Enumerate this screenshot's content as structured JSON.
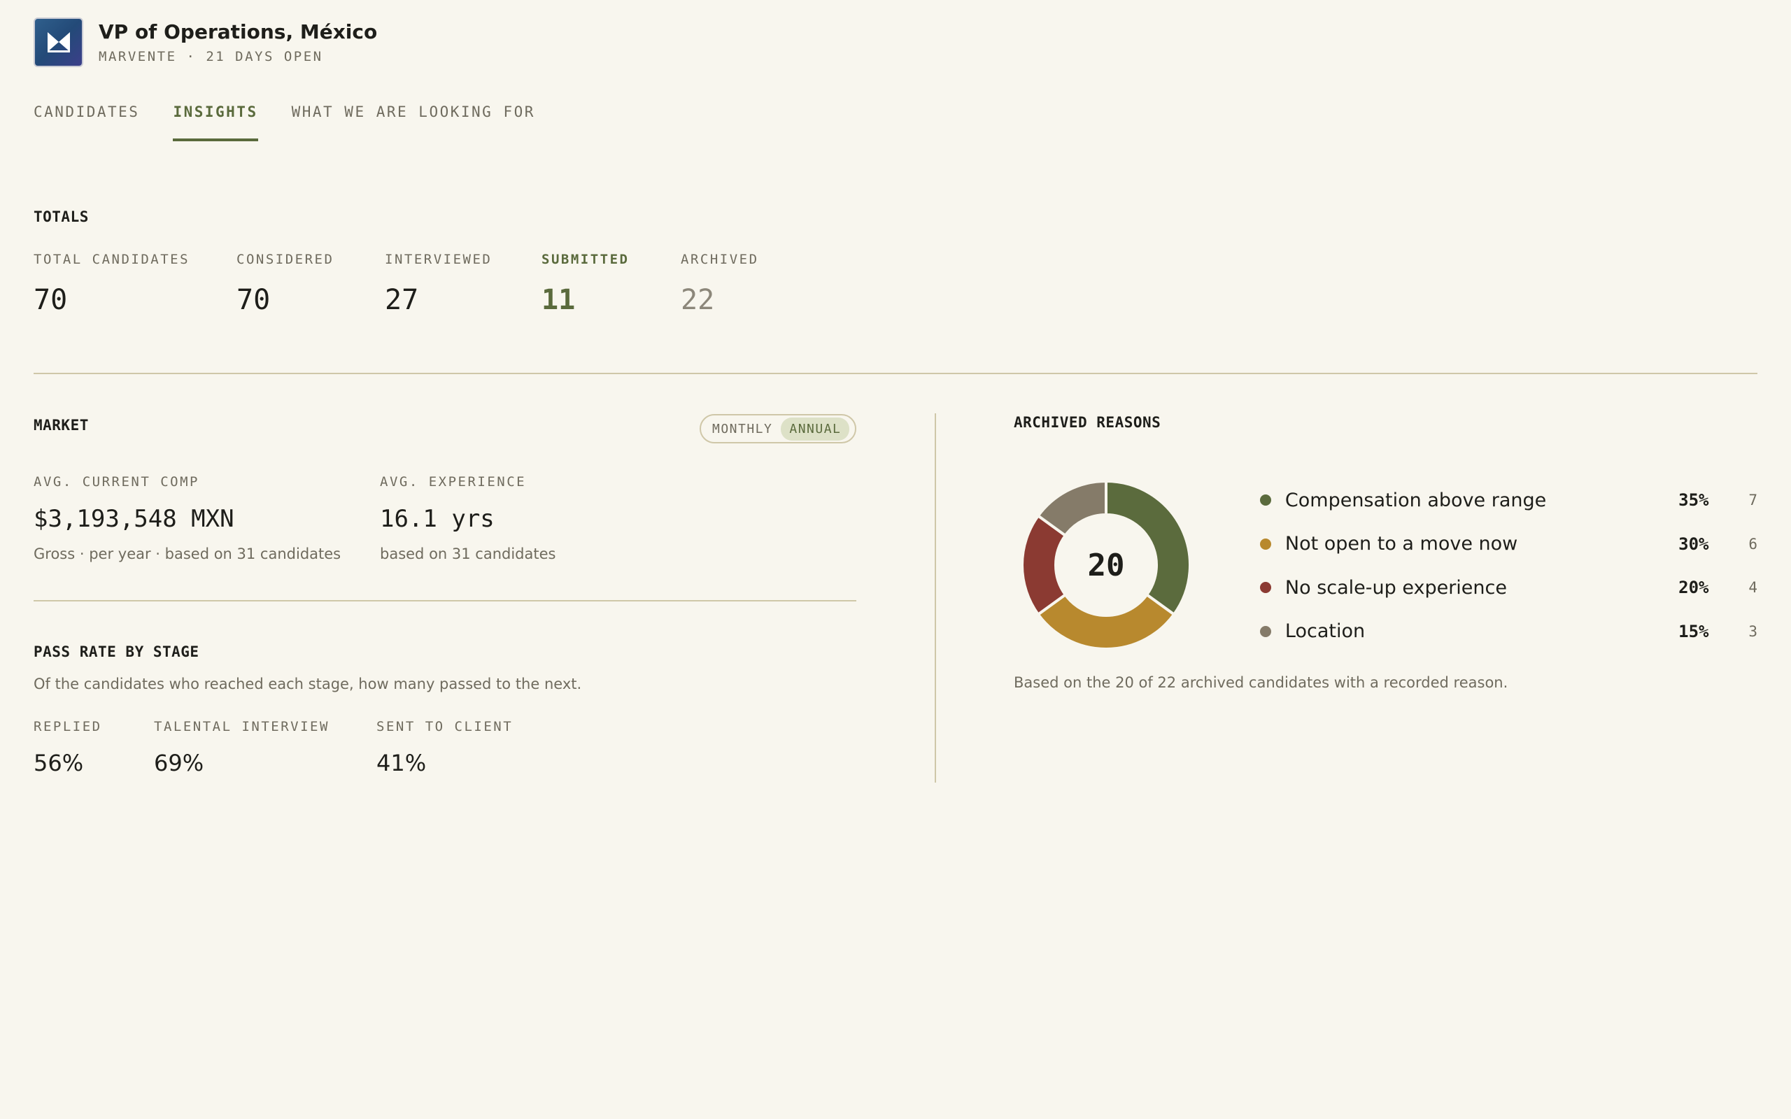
{
  "header": {
    "title": "VP of Operations, México",
    "subtitle": "MARVENTE · 21 DAYS OPEN"
  },
  "tabs": [
    {
      "label": "CANDIDATES",
      "active": false
    },
    {
      "label": "INSIGHTS",
      "active": true
    },
    {
      "label": "WHAT WE ARE LOOKING FOR",
      "active": false
    }
  ],
  "totals": {
    "heading": "TOTALS",
    "items": [
      {
        "label": "TOTAL CANDIDATES",
        "value": "70"
      },
      {
        "label": "CONSIDERED",
        "value": "70"
      },
      {
        "label": "INTERVIEWED",
        "value": "27"
      },
      {
        "label": "SUBMITTED",
        "value": "11"
      },
      {
        "label": "ARCHIVED",
        "value": "22"
      }
    ]
  },
  "market": {
    "heading": "MARKET",
    "toggle": {
      "monthly": "MONTHLY",
      "annual": "ANNUAL",
      "selected": "ANNUAL"
    },
    "comp": {
      "label": "AVG. CURRENT COMP",
      "value": "$3,193,548 MXN",
      "note": "Gross · per year · based on 31 candidates"
    },
    "experience": {
      "label": "AVG. EXPERIENCE",
      "value": "16.1 yrs",
      "note": "based on 31 candidates"
    }
  },
  "pass_rate": {
    "heading": "PASS RATE BY STAGE",
    "description": "Of the candidates who reached each stage, how many passed to the next.",
    "stages": [
      {
        "label": "REPLIED",
        "value": "56%"
      },
      {
        "label": "TALENTAL INTERVIEW",
        "value": "69%"
      },
      {
        "label": "SENT TO CLIENT",
        "value": "41%"
      }
    ]
  },
  "archived_reasons": {
    "heading": "ARCHIVED REASONS",
    "center_total": "20",
    "reasons": [
      {
        "label": "Compensation above range",
        "pct": "35%",
        "count": "7",
        "color": "#5b6b3d"
      },
      {
        "label": "Not open to a move now",
        "pct": "30%",
        "count": "6",
        "color": "#b8892e"
      },
      {
        "label": "No scale-up experience",
        "pct": "20%",
        "count": "4",
        "color": "#8b3a32"
      },
      {
        "label": "Location",
        "pct": "15%",
        "count": "3",
        "color": "#857b69"
      }
    ],
    "note": "Based on the 20 of 22 archived candidates with a recorded reason."
  },
  "colors": {
    "accent": "#5a6a3c",
    "background": "#f8f6ee",
    "muted": "#6f6b5e"
  }
}
